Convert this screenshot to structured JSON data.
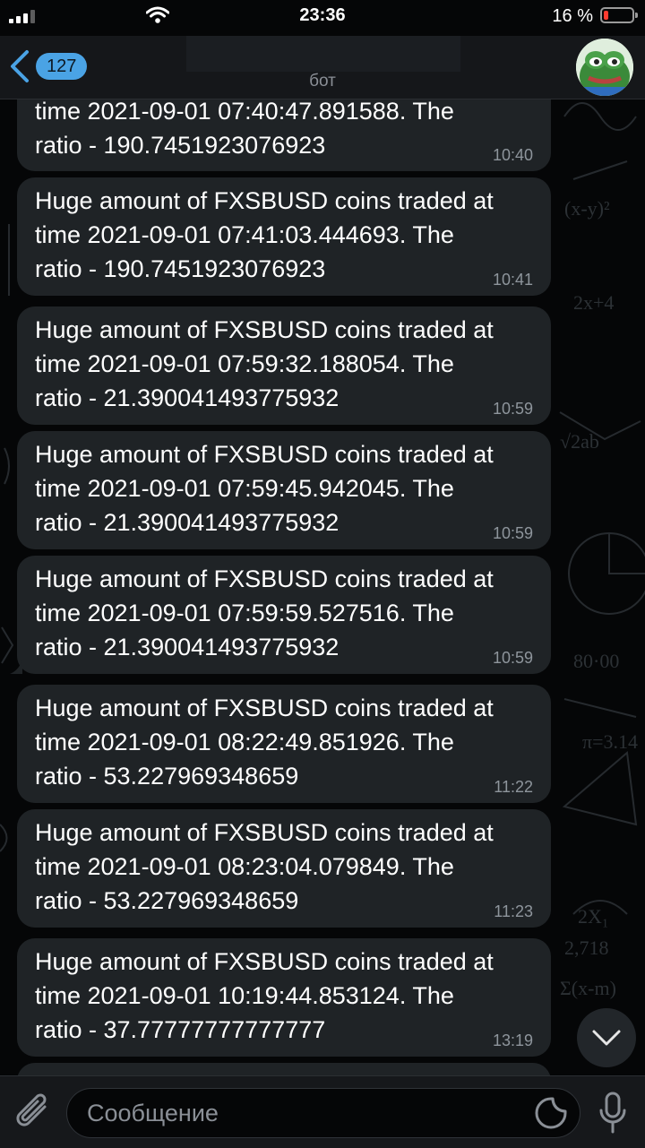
{
  "status_bar": {
    "time": "23:36",
    "battery_percent": "16 %",
    "battery_level": 0.16,
    "battery_color": "#ff3b30"
  },
  "header": {
    "back_badge": "127",
    "subtitle": "бот",
    "accent_color": "#4aa3e5"
  },
  "messages": [
    {
      "text": "time 2021-09-01 07:40:47.891588. The\nratio - 190.7451923076923",
      "time": "10:40"
    },
    {
      "text": "Huge amount of FXSBUSD coins traded at\ntime 2021-09-01 07:41:03.444693. The\nratio - 190.7451923076923",
      "time": "10:41"
    },
    {
      "text": "Huge amount of FXSBUSD coins traded at\ntime 2021-09-01 07:59:32.188054. The\nratio - 21.390041493775932",
      "time": "10:59"
    },
    {
      "text": "Huge amount of FXSBUSD coins traded at\ntime 2021-09-01 07:59:45.942045. The\nratio - 21.390041493775932",
      "time": "10:59"
    },
    {
      "text": "Huge amount of FXSBUSD coins traded at\ntime 2021-09-01 07:59:59.527516. The\nratio - 21.390041493775932",
      "time": "10:59"
    },
    {
      "text": "Huge amount of FXSBUSD coins traded at\ntime 2021-09-01 08:22:49.851926. The\nratio - 53.227969348659",
      "time": "11:22"
    },
    {
      "text": "Huge amount of FXSBUSD coins traded at\ntime 2021-09-01 08:23:04.079849. The\nratio - 53.227969348659",
      "time": "11:23"
    },
    {
      "text": "Huge amount of FXSBUSD coins traded at\ntime 2021-09-01 10:19:44.853124. The\nratio - 37.77777777777777",
      "time": "13:19"
    }
  ],
  "composer": {
    "placeholder": "Сообщение"
  },
  "icons": [
    "signal-icon",
    "wifi-icon",
    "battery-icon",
    "back-chevron-icon",
    "avatar-image",
    "scroll-down-chevron-icon",
    "paperclip-icon",
    "sticker-icon",
    "microphone-icon"
  ]
}
